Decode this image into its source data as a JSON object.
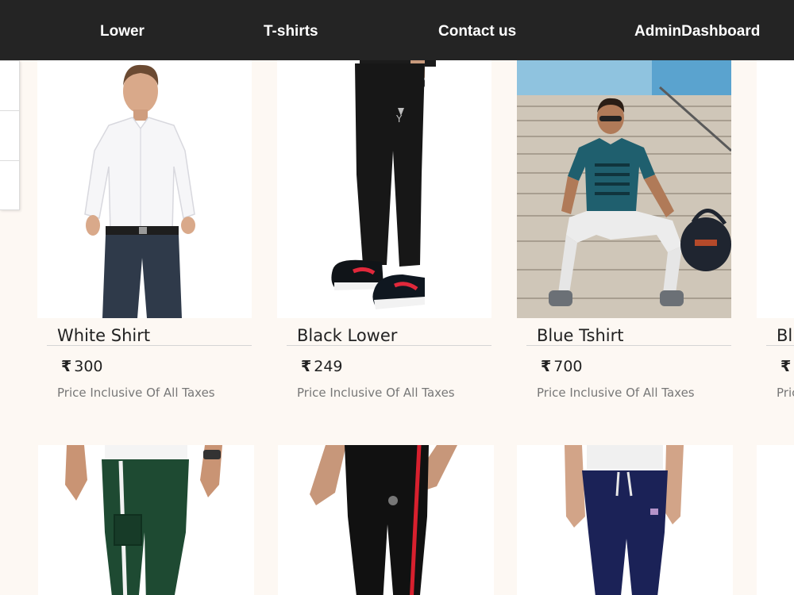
{
  "nav": {
    "items": [
      {
        "label": "Lower"
      },
      {
        "label": "T-shirts"
      },
      {
        "label": "Contact us"
      },
      {
        "label": "AdminDashboard"
      }
    ]
  },
  "products": [
    {
      "title": "White Shirt",
      "currency": "₹",
      "price": "300",
      "note": "Price Inclusive Of All Taxes",
      "image": "white-shirt-photo"
    },
    {
      "title": "Black Lower",
      "currency": "₹",
      "price": "249",
      "note": "Price Inclusive Of All Taxes",
      "image": "black-lower-photo"
    },
    {
      "title": "Blue Tshirt",
      "currency": "₹",
      "price": "700",
      "note": "Price Inclusive Of All Taxes",
      "image": "blue-tshirt-photo"
    },
    {
      "title": "Blu",
      "currency": "₹",
      "note": "Pric"
    }
  ],
  "second_row": [
    {
      "image": "green-cargo-pants-photo"
    },
    {
      "image": "black-track-pants-photo"
    },
    {
      "image": "navy-joggers-photo"
    }
  ]
}
